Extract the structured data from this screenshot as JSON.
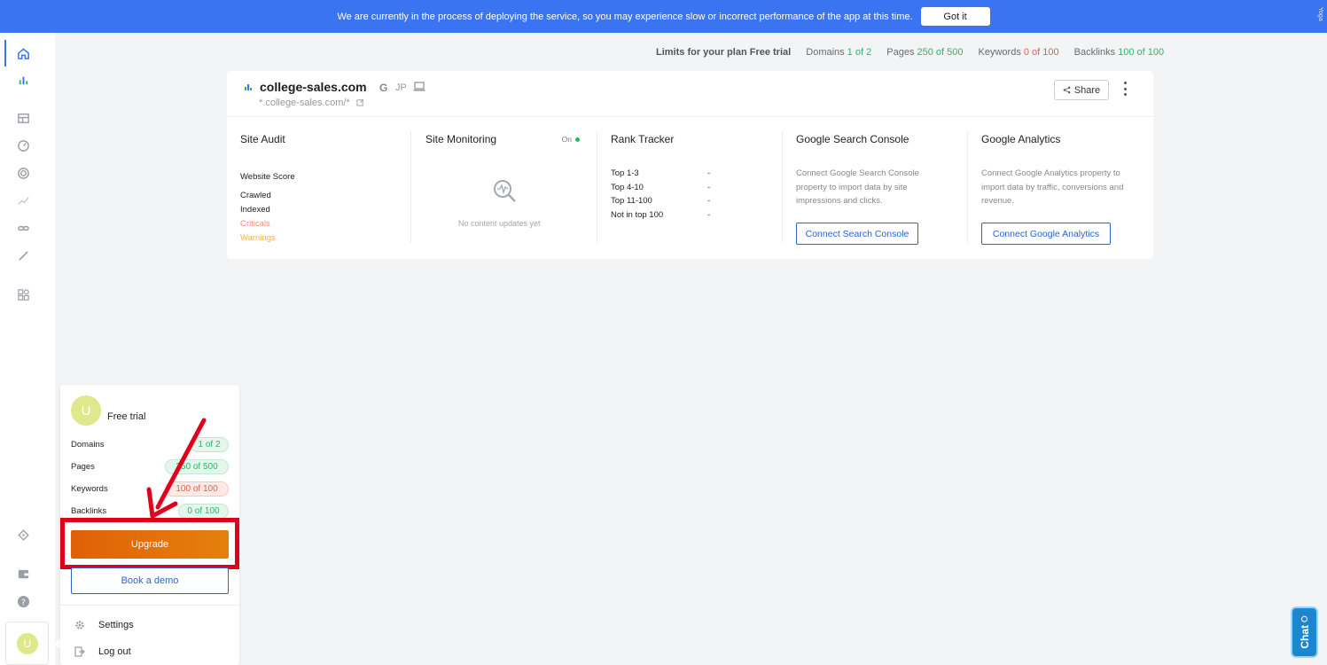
{
  "banner": {
    "message": "We are currently in the process of deploying the service, so you may experience slow or incorrect performance of the app at this time.",
    "button": "Got it",
    "side_text": "Yoga"
  },
  "limits": {
    "title": "Limits for your plan Free trial",
    "domains_label": "Domains",
    "domains_value": "1 of 2",
    "pages_label": "Pages",
    "pages_value": "250 of 500",
    "keywords_label": "Keywords",
    "keywords_value": "0 of 100",
    "backlinks_label": "Backlinks",
    "backlinks_value": "100 of 100"
  },
  "site": {
    "domain": "college-sales.com",
    "search_engine": "G",
    "region": "JP",
    "url": "*.college-sales.com/*",
    "share": "Share"
  },
  "audit": {
    "title": "Site Audit",
    "placeholder": "-",
    "score": "Website Score",
    "crawled": "Crawled",
    "indexed": "Indexed",
    "criticals": "Criticals",
    "warnings": "Warnings"
  },
  "monitoring": {
    "title": "Site Monitoring",
    "status": "On",
    "empty": "No content updates yet"
  },
  "rank": {
    "title": "Rank Tracker",
    "rows": [
      {
        "label": "Top 1-3",
        "value": "-"
      },
      {
        "label": "Top 4-10",
        "value": "-"
      },
      {
        "label": "Top 11-100",
        "value": "-"
      },
      {
        "label": "Not in top 100",
        "value": "-"
      }
    ]
  },
  "gsc": {
    "title": "Google Search Console",
    "desc": "Connect Google Search Console property to import data by site impressions and clicks.",
    "button": "Connect Search Console"
  },
  "ga": {
    "title": "Google Analytics",
    "desc": "Connect Google Analytics property to import data by traffic, conversions and revenue.",
    "button": "Connect Google Analytics"
  },
  "popup": {
    "avatar": "U",
    "plan": "Free trial",
    "rows": [
      {
        "label": "Domains",
        "value": "1 of 2"
      },
      {
        "label": "Pages",
        "value": "250 of 500"
      },
      {
        "label": "Keywords",
        "value": "100 of 100"
      },
      {
        "label": "Backlinks",
        "value": "0 of 100"
      }
    ],
    "upgrade": "Upgrade",
    "demo": "Book a demo",
    "settings": "Settings",
    "logout": "Log out"
  },
  "sidebar": {
    "avatar": "U"
  },
  "chat": {
    "label": "Chat"
  },
  "colors": {
    "accent": "#3b74f0",
    "upgrade": "#e06006",
    "highlight": "#e0001b",
    "good": "#2fb36b",
    "bad": "#e0604b"
  }
}
